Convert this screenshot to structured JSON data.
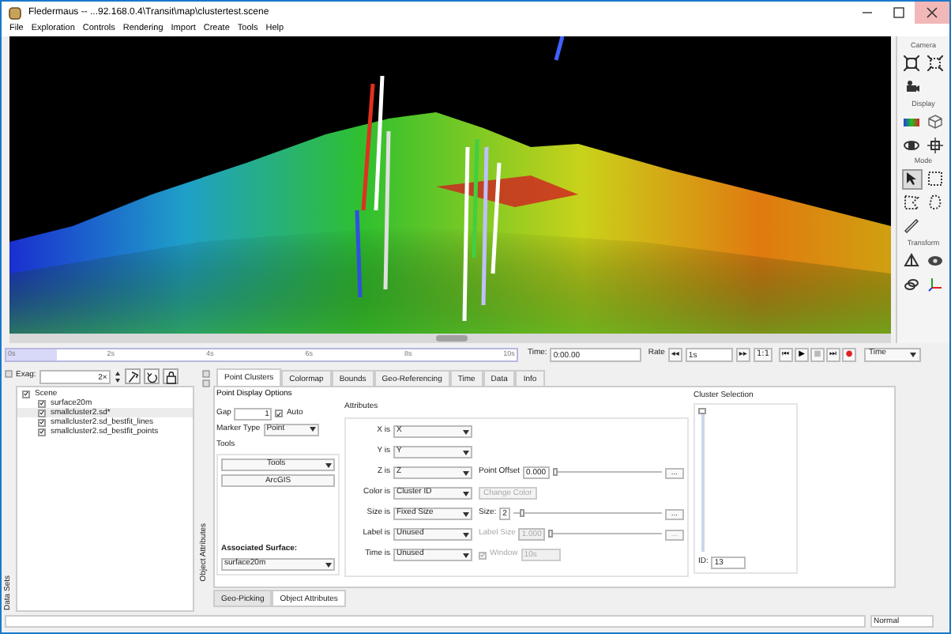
{
  "window": {
    "title": "Fledermaus -- ...92.168.0.4\\Transit\\map\\clustertest.scene"
  },
  "menu": [
    {
      "label": "File"
    },
    {
      "label": "Exploration"
    },
    {
      "label": "Controls"
    },
    {
      "label": "Rendering"
    },
    {
      "label": "Import"
    },
    {
      "label": "Create"
    },
    {
      "label": "Tools"
    },
    {
      "label": "Help"
    }
  ],
  "toolbar": [
    {
      "title": "Camera",
      "tools": [
        {
          "kind": "frame",
          "selected": false
        },
        {
          "kind": "frame-dash",
          "selected": false
        },
        {
          "kind": "camera",
          "selected": false
        }
      ]
    },
    {
      "title": "Display",
      "tools": [
        {
          "kind": "colorbar",
          "selected": false
        },
        {
          "kind": "cube",
          "selected": false
        },
        {
          "kind": "orbit",
          "selected": false
        },
        {
          "kind": "axes-cube",
          "selected": false
        }
      ]
    },
    {
      "title": "Mode",
      "tools": [
        {
          "kind": "pointer",
          "selected": true
        },
        {
          "kind": "dash-square",
          "selected": false
        },
        {
          "kind": "dash-poly",
          "selected": false
        },
        {
          "kind": "lasso",
          "selected": false
        },
        {
          "kind": "ruler",
          "selected": false
        }
      ]
    },
    {
      "title": "Transform",
      "tools": [
        {
          "kind": "pyramid",
          "selected": false
        },
        {
          "kind": "eye",
          "selected": false
        },
        {
          "kind": "stack",
          "selected": false
        },
        {
          "kind": "axes",
          "selected": false
        }
      ]
    }
  ],
  "timeline": {
    "ticks": [
      "0s",
      "2s",
      "4s",
      "6s",
      "8s",
      "10s"
    ],
    "level": 0.1,
    "time_label": "Time:",
    "time_value": "0:00.00",
    "rate_label": "Rate",
    "rewind": "◂◂",
    "rate_value": "1s",
    "forward": "▸▸",
    "ratio": "1:1",
    "transport": [
      {
        "glyph": "⏮",
        "disabled": false
      },
      {
        "glyph": "▶",
        "disabled": false
      },
      {
        "glyph": "■",
        "disabled": true
      },
      {
        "glyph": "⏭",
        "disabled": false
      },
      {
        "glyph": "●",
        "disabled": false,
        "color": "#e02020"
      }
    ],
    "mode": "Time"
  },
  "data_sets": {
    "side_label": "Data Sets",
    "exag_label": "Exag:",
    "exag_value": "2×",
    "tree": [
      {
        "label": "Scene",
        "checked": true,
        "selected": false,
        "children": [
          {
            "label": "surface20m",
            "checked": true,
            "selected": false
          },
          {
            "label": "smallcluster2.sd*",
            "checked": true,
            "selected": true
          },
          {
            "label": "smallcluster2.sd_bestfit_lines",
            "checked": true,
            "selected": false
          },
          {
            "label": "smallcluster2.sd_bestfit_points",
            "checked": true,
            "selected": false
          }
        ]
      }
    ]
  },
  "object_attributes": {
    "side_label": "Object Attributes",
    "tabs": [
      {
        "label": "Point Clusters",
        "selected": true
      },
      {
        "label": "Colormap",
        "selected": false
      },
      {
        "label": "Bounds",
        "selected": false
      },
      {
        "label": "Geo-Referencing",
        "selected": false
      },
      {
        "label": "Time",
        "selected": false
      },
      {
        "label": "Data",
        "selected": false
      },
      {
        "label": "Info",
        "selected": false
      }
    ],
    "point_display": {
      "title": "Point Display Options",
      "gap_label": "Gap",
      "gap_value": "1",
      "auto_label": "Auto",
      "auto_checked": true,
      "marker_type_label": "Marker Type",
      "marker_type": "Point",
      "tools_title": "Tools",
      "tools_dropdown": "Tools",
      "arcgis_button": "ArcGIS",
      "surface_label": "Associated Surface:",
      "surface_value": "surface20m"
    },
    "attributes": {
      "title": "Attributes",
      "rows": [
        {
          "label": "X is",
          "value": "X",
          "kind": "plain"
        },
        {
          "label": "Y is",
          "value": "Y",
          "kind": "plain"
        },
        {
          "label": "Z is",
          "value": "Z",
          "kind": "slider",
          "extra": {
            "label": "Point Offset",
            "value": "0.000",
            "level": 0,
            "disabled": false,
            "more": "..."
          }
        },
        {
          "label": "Color is",
          "value": "Cluster ID",
          "kind": "button",
          "extra": {
            "label": "Change Color",
            "disabled": true
          }
        },
        {
          "label": "Size is",
          "value": "Fixed Size",
          "kind": "slider",
          "extra": {
            "label": "Size:",
            "value": "2",
            "level": 0.05,
            "disabled": false,
            "more": "..."
          }
        },
        {
          "label": "Label is",
          "value": "Unused",
          "kind": "slider",
          "extra": {
            "label": "Label Size",
            "value": "1.000",
            "level": 0,
            "disabled": true,
            "more": "..."
          }
        },
        {
          "label": "Time is",
          "value": "Unused",
          "kind": "check",
          "extra": {
            "label": "Window",
            "checked": true,
            "disabled": true,
            "value": "10s"
          }
        }
      ]
    },
    "cluster_selection": {
      "title": "Cluster Selection",
      "level": 1,
      "id_label": "ID:",
      "id_value": "13"
    }
  },
  "bottom_tabs": [
    {
      "label": "Geo-Picking",
      "selected": false
    },
    {
      "label": "Object Attributes",
      "selected": true
    }
  ],
  "status_bar": {
    "mode": "Normal"
  }
}
